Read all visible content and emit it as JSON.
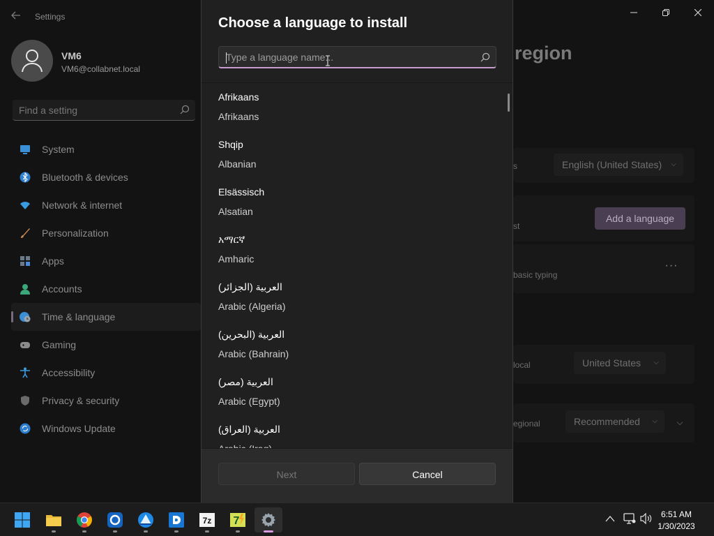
{
  "window": {
    "app_title": "Settings",
    "page_heading": "region"
  },
  "profile": {
    "name": "VM6",
    "email": "VM6@collabnet.local"
  },
  "find": {
    "placeholder": "Find a setting"
  },
  "nav": [
    {
      "label": "System",
      "icon": "monitor-icon",
      "color": "#3a8fd6"
    },
    {
      "label": "Bluetooth & devices",
      "icon": "bluetooth-icon",
      "color": "#2f7fd0"
    },
    {
      "label": "Network & internet",
      "icon": "wifi-icon",
      "color": "#3a9be0"
    },
    {
      "label": "Personalization",
      "icon": "brush-icon",
      "color": "#c58a50"
    },
    {
      "label": "Apps",
      "icon": "apps-icon",
      "color": "#6a7a8a"
    },
    {
      "label": "Accounts",
      "icon": "person-icon",
      "color": "#3aa87a"
    },
    {
      "label": "Time & language",
      "icon": "globe-clock-icon",
      "color": "#3a8fd6",
      "selected": true
    },
    {
      "label": "Gaming",
      "icon": "gamepad-icon",
      "color": "#8a8a8a"
    },
    {
      "label": "Accessibility",
      "icon": "accessibility-icon",
      "color": "#3a9be0"
    },
    {
      "label": "Privacy & security",
      "icon": "shield-icon",
      "color": "#6a6a6a"
    },
    {
      "label": "Windows Update",
      "icon": "update-icon",
      "color": "#2f7fd0"
    }
  ],
  "background_page": {
    "display_language_value": "English (United States)",
    "add_language_label": "Add a language",
    "basic_typing_text": "basic typing",
    "country_value": "United States",
    "regional_format_value": "Recommended",
    "more_label": "···",
    "fragment_s": "s",
    "fragment_st": "st",
    "fragment_local": "local",
    "fragment_regional": "egional"
  },
  "dialog": {
    "title": "Choose a language to install",
    "search_placeholder": "Type a language name...",
    "languages": [
      {
        "native": "Afrikaans",
        "english": "Afrikaans"
      },
      {
        "native": "Shqip",
        "english": "Albanian"
      },
      {
        "native": "Elsässisch",
        "english": "Alsatian"
      },
      {
        "native": "አማርኛ",
        "english": "Amharic"
      },
      {
        "native": "العربية (الجزائر)",
        "english": "Arabic (Algeria)"
      },
      {
        "native": "العربية (البحرين)",
        "english": "Arabic (Bahrain)"
      },
      {
        "native": "العربية (مصر)",
        "english": "Arabic (Egypt)"
      },
      {
        "native": "العربية (العراق)",
        "english": "Arabic (Iraq)"
      }
    ],
    "next_label": "Next",
    "cancel_label": "Cancel"
  },
  "taskbar": {
    "apps": [
      {
        "name": "start-icon"
      },
      {
        "name": "file-explorer-icon"
      },
      {
        "name": "chrome-icon"
      },
      {
        "name": "app-blue-icon"
      },
      {
        "name": "app-triangle-icon"
      },
      {
        "name": "app-d-icon"
      },
      {
        "name": "7zip-icon",
        "label": "7z"
      },
      {
        "name": "7z-app-icon",
        "label": "7"
      },
      {
        "name": "settings-gear-icon",
        "active": true
      }
    ],
    "clock_time": "6:51 AM",
    "clock_date": "1/30/2023"
  }
}
